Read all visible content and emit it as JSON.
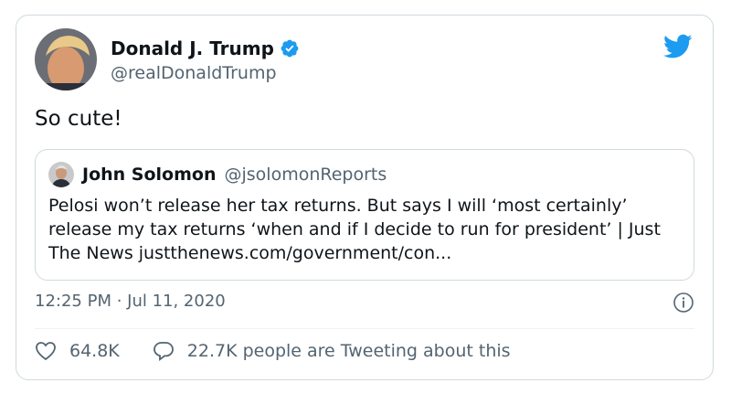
{
  "author": {
    "display_name": "Donald J. Trump",
    "handle": "@realDonaldTrump",
    "verified": true
  },
  "tweet": {
    "text": "So cute!"
  },
  "quoted_tweet": {
    "display_name": "John Solomon",
    "handle": "@jsolomonReports",
    "text": "Pelosi won’t release her tax returns. But says I will ‘most certainly’ release my tax returns ‘when and if I decide to run for president’ | Just The News justthenews.com/government/con..."
  },
  "meta": {
    "timestamp": "12:25 PM · Jul 11, 2020"
  },
  "actions": {
    "like_count": "64.8K",
    "tweeting_text": "22.7K people are Tweeting about this"
  },
  "colors": {
    "brand_blue": "#1d9bf0",
    "text_primary": "#0f1419",
    "text_secondary": "#536471",
    "border": "#cfd9de"
  },
  "icons": [
    "twitter-bird-icon",
    "verified-badge-icon",
    "info-icon",
    "heart-icon",
    "reply-bubble-icon"
  ]
}
